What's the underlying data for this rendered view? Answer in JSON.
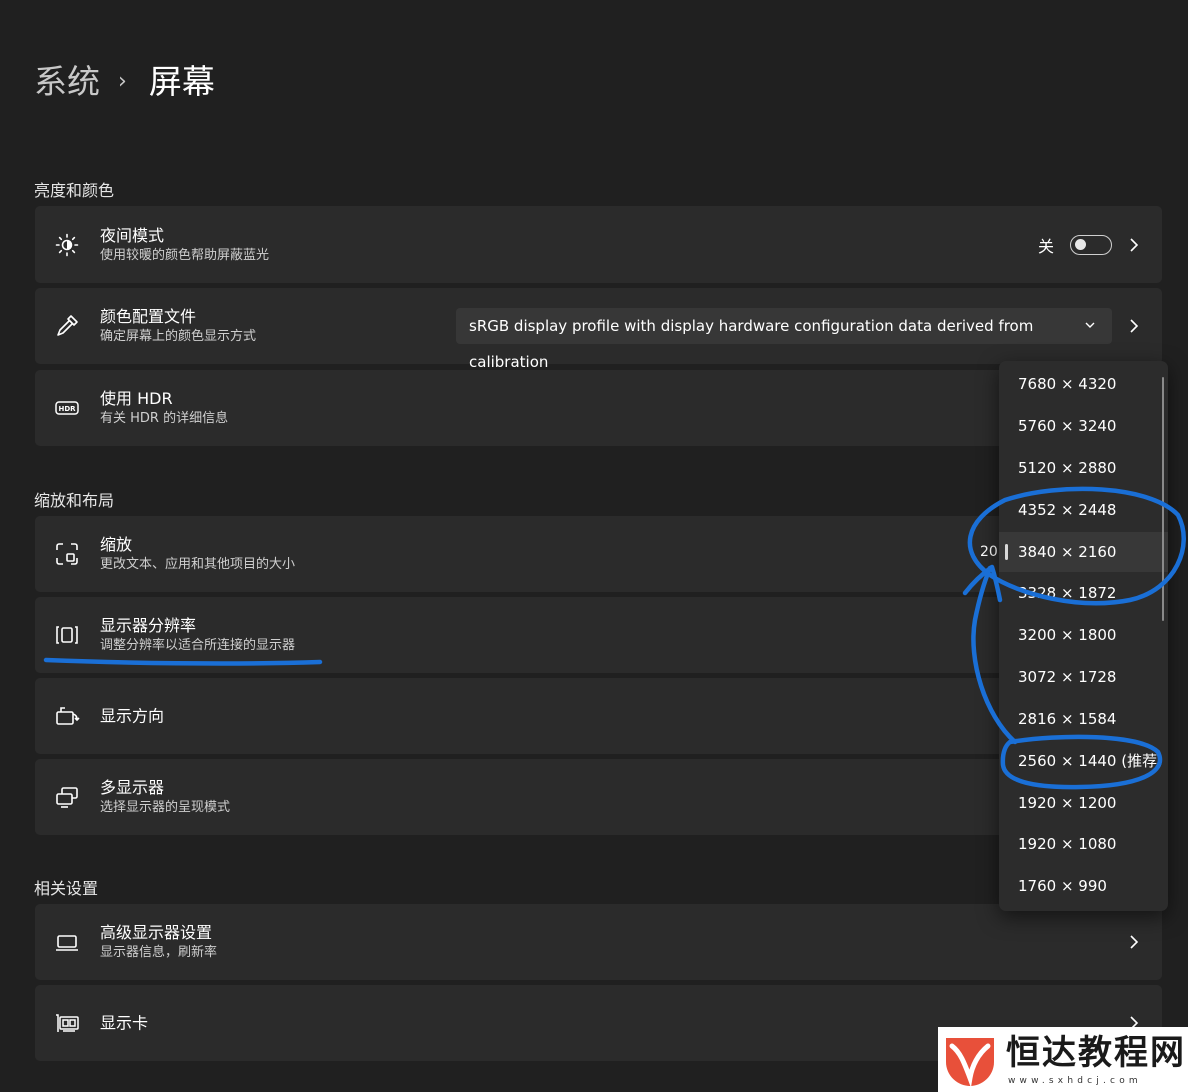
{
  "breadcrumb": {
    "parent": "系统",
    "separator": "›",
    "current": "屏幕"
  },
  "sections": {
    "brightness": "亮度和颜色",
    "scale_layout": "缩放和布局",
    "related": "相关设置"
  },
  "night_light": {
    "title": "夜间模式",
    "subtitle": "使用较暖的颜色帮助屏蔽蓝光",
    "state_label": "关",
    "enabled": false
  },
  "color_profile": {
    "title": "颜色配置文件",
    "subtitle": "确定屏幕上的颜色显示方式",
    "value": "sRGB display profile with display hardware configuration data derived from calibration"
  },
  "hdr": {
    "title": "使用 HDR",
    "subtitle": "有关 HDR 的详细信息"
  },
  "scale": {
    "title": "缩放",
    "subtitle": "更改文本、应用和其他项目的大小",
    "value_partial": "20("
  },
  "resolution": {
    "title": "显示器分辨率",
    "subtitle": "调整分辨率以适合所连接的显示器"
  },
  "orientation": {
    "title": "显示方向"
  },
  "multi_display": {
    "title": "多显示器",
    "subtitle": "选择显示器的呈现模式"
  },
  "advanced_display": {
    "title": "高级显示器设置",
    "subtitle": "显示器信息，刷新率"
  },
  "graphics": {
    "title": "显示卡"
  },
  "resolution_options": [
    "7680 × 4320",
    "5760 × 3240",
    "5120 × 2880",
    "4352 × 2448",
    "3840 × 2160",
    "3328 × 1872",
    "3200 × 1800",
    "3072 × 1728",
    "2816 × 1584",
    "2560 × 1440 (推荐)",
    "1920 × 1200",
    "1920 × 1080",
    "1760 × 990"
  ],
  "resolution_selected": "3840 × 2160",
  "annotation_color": "#1a6fd6",
  "accent_color": "#d8d8d8",
  "watermark": {
    "name": "恒达教程网",
    "url": "www.sxhdcj.com",
    "logo_color": "#e8503a"
  }
}
